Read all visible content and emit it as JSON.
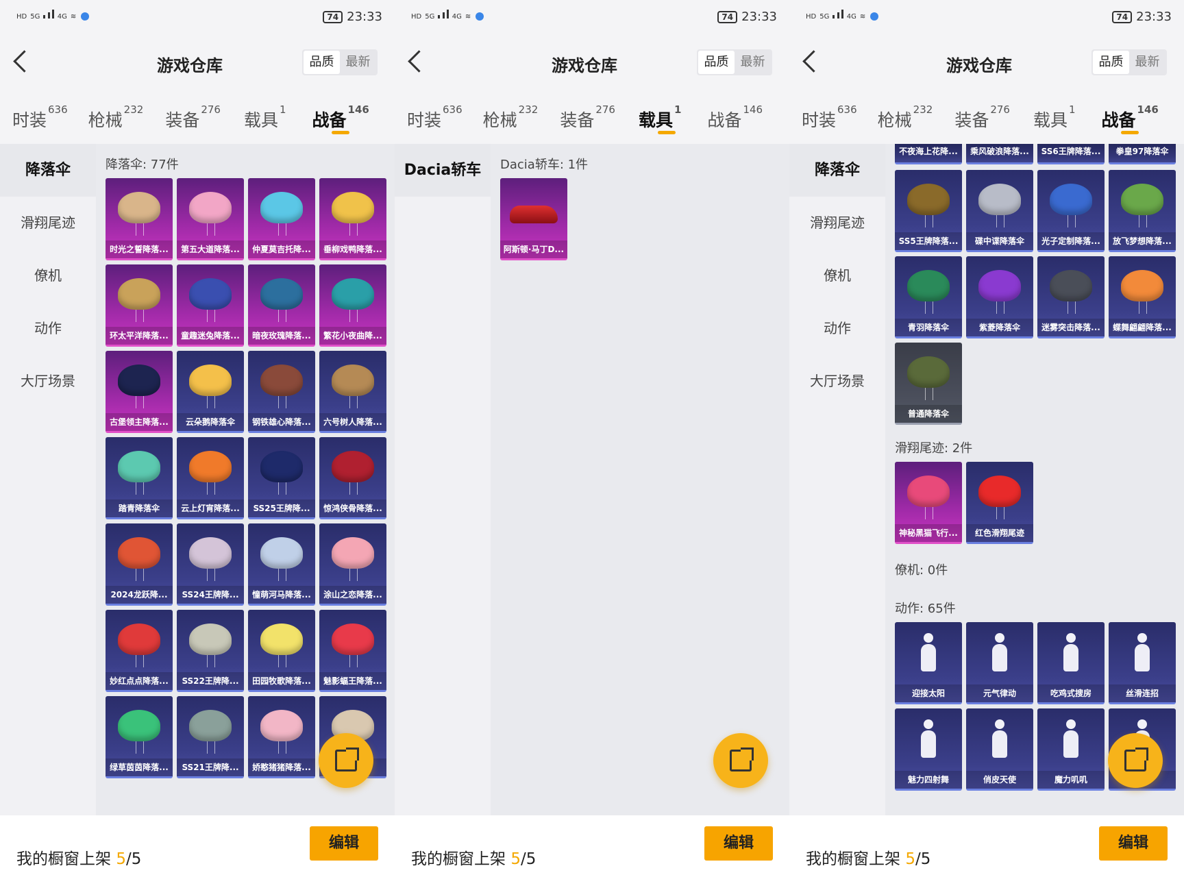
{
  "status": {
    "time": "23:33",
    "battery": "74",
    "net1": "5G",
    "net2": "4G",
    "hd": "HD"
  },
  "header": {
    "title": "游戏仓库",
    "sort_quality": "品质",
    "sort_newest": "最新"
  },
  "tabs": [
    {
      "label": "时装",
      "count": "636"
    },
    {
      "label": "枪械",
      "count": "232"
    },
    {
      "label": "装备",
      "count": "276"
    },
    {
      "label": "载具",
      "count": "1"
    },
    {
      "label": "战备",
      "count": "146"
    }
  ],
  "side_categories": [
    "降落伞",
    "滑翔尾迹",
    "僚机",
    "动作",
    "大厅场景"
  ],
  "screen1": {
    "section_title": "降落伞: 77件",
    "items": [
      {
        "label": "时光之誓降落...",
        "tier": "pink",
        "color": "#d9b58a"
      },
      {
        "label": "第五大道降落...",
        "tier": "pink",
        "color": "#f2a6c6"
      },
      {
        "label": "仲夏莫吉托降...",
        "tier": "pink",
        "color": "#5bc7e6"
      },
      {
        "label": "垂柳戏鸭降落...",
        "tier": "pink",
        "color": "#f0c24a"
      },
      {
        "label": "环太平洋降落...",
        "tier": "pink",
        "color": "#c9a25a"
      },
      {
        "label": "童趣迷兔降落...",
        "tier": "pink",
        "color": "#3a4fb0"
      },
      {
        "label": "暗夜玫瑰降落...",
        "tier": "pink",
        "color": "#2c6f9e"
      },
      {
        "label": "繁花小夜曲降...",
        "tier": "pink",
        "color": "#2a9fa8"
      },
      {
        "label": "古堡领主降落...",
        "tier": "pink",
        "color": "#1d2450"
      },
      {
        "label": "云朵鹅降落伞",
        "tier": "blue",
        "color": "#f4c04a"
      },
      {
        "label": "钢铁雄心降落...",
        "tier": "blue",
        "color": "#8a4a3a"
      },
      {
        "label": "六号树人降落...",
        "tier": "blue",
        "color": "#b58a55"
      },
      {
        "label": "踏青降落伞",
        "tier": "blue",
        "color": "#5cc9b0"
      },
      {
        "label": "云上灯宵降落...",
        "tier": "blue",
        "color": "#f07a2a"
      },
      {
        "label": "SS25王牌降...",
        "tier": "blue",
        "color": "#1e2a6a"
      },
      {
        "label": "惊鸿侠骨降落...",
        "tier": "blue",
        "color": "#b02030"
      },
      {
        "label": "2024龙跃降...",
        "tier": "blue",
        "color": "#e05535"
      },
      {
        "label": "SS24王牌降...",
        "tier": "blue",
        "color": "#d4c4d8"
      },
      {
        "label": "憧萌河马降落...",
        "tier": "blue",
        "color": "#c0d0e8"
      },
      {
        "label": "涂山之恋降落...",
        "tier": "blue",
        "color": "#f4a6b4"
      },
      {
        "label": "妙红点点降落...",
        "tier": "blue",
        "color": "#e03a3a"
      },
      {
        "label": "SS22王牌降...",
        "tier": "blue",
        "color": "#c8c8b8"
      },
      {
        "label": "田园牧歌降落...",
        "tier": "blue",
        "color": "#f2e26a"
      },
      {
        "label": "魅影蝠王降落...",
        "tier": "blue",
        "color": "#e83a4a"
      },
      {
        "label": "绿草茵茵降落...",
        "tier": "blue",
        "color": "#3ac27a"
      },
      {
        "label": "SS21王牌降...",
        "tier": "blue",
        "color": "#8aa09a"
      },
      {
        "label": "娇憨猪猪降落...",
        "tier": "blue",
        "color": "#f2b6c6"
      },
      {
        "label": "",
        "tier": "blue",
        "color": "#d9c8b0"
      }
    ]
  },
  "screen2": {
    "side_category": "Dacia轿车",
    "section_title": "Dacia轿车: 1件",
    "items": [
      {
        "label": "阿斯顿·马丁D...",
        "tier": "pink"
      }
    ]
  },
  "screen3": {
    "top_strip": [
      "不夜海上花降...",
      "乘风破浪降落...",
      "SS6王牌降落...",
      "拳皇97降落伞"
    ],
    "parachutes": [
      {
        "label": "SS5王牌降落...",
        "tier": "blue",
        "color": "#8a6a2a"
      },
      {
        "label": "碟中谍降落伞",
        "tier": "blue",
        "color": "#b8bcc8"
      },
      {
        "label": "光子定制降落...",
        "tier": "blue",
        "color": "#3a6ad0"
      },
      {
        "label": "放飞梦想降落...",
        "tier": "blue",
        "color": "#6aa84a"
      },
      {
        "label": "青羽降落伞",
        "tier": "blue",
        "color": "#2a8a5a"
      },
      {
        "label": "紫菱降落伞",
        "tier": "blue",
        "color": "#8a3ad0"
      },
      {
        "label": "迷雾突击降落...",
        "tier": "blue",
        "color": "#4a4e58"
      },
      {
        "label": "蝶舞翩翩降落...",
        "tier": "blue",
        "color": "#f28a3a"
      },
      {
        "label": "普通降落伞",
        "tier": "gray",
        "color": "#5a6a3a"
      }
    ],
    "trail_title": "滑翔尾迹: 2件",
    "trails": [
      {
        "label": "神秘黑猫飞行...",
        "tier": "pink",
        "color": "#e84a7a"
      },
      {
        "label": "红色滑翔尾迹",
        "tier": "blue",
        "color": "#e82a2a"
      }
    ],
    "wingman_title": "僚机: 0件",
    "emote_title": "动作: 65件",
    "emotes": [
      {
        "label": "迎接太阳"
      },
      {
        "label": "元气律动"
      },
      {
        "label": "吃鸡式搜房"
      },
      {
        "label": "丝滑连招"
      },
      {
        "label": "魅力四射舞"
      },
      {
        "label": "俏皮天使"
      },
      {
        "label": "魔力叽叽"
      },
      {
        "label": ""
      }
    ]
  },
  "footer": {
    "text": "我的橱窗上架 ",
    "current": "5",
    "total": "/5",
    "edit": "编辑"
  }
}
